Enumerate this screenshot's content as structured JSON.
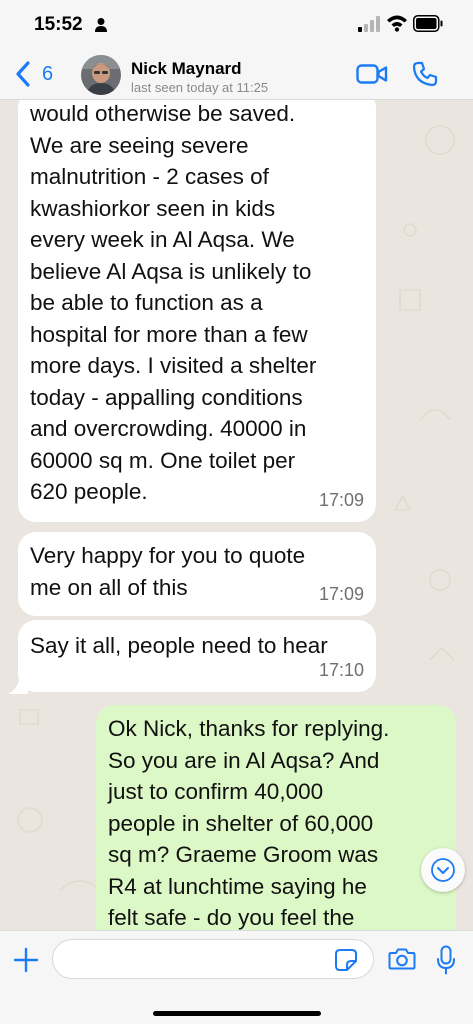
{
  "status_bar": {
    "time": "15:52"
  },
  "header": {
    "back_count": "6",
    "contact_name": "Nick Maynard",
    "last_seen": "last seen today at 11:25"
  },
  "messages": [
    {
      "direction": "incoming",
      "text": "would otherwise be saved.\nWe are seeing severe\nmalnutrition - 2 cases of\nkwashiorkor seen in kids\nevery week in Al Aqsa. We\nbelieve Al Aqsa is unlikely to\nbe able to function as a\nhospital for more than a few\nmore days. I visited a shelter\ntoday - appalling conditions\nand overcrowding. 40000 in\n60000 sq m. One toilet per\n620 people.",
      "time": "17:09"
    },
    {
      "direction": "incoming",
      "text": "Very happy for you to quote\nme on all of this",
      "time": "17:09"
    },
    {
      "direction": "incoming",
      "text": "Say it all, people need to hear",
      "time": "17:10"
    },
    {
      "direction": "outgoing",
      "text": "Ok Nick, thanks for replying.\nSo you are in Al Aqsa? And\njust to confirm 40,000\npeople in shelter of 60,000\nsq m? Graeme Groom was\nR4 at lunchtime saying he\nfelt safe - do you feel the",
      "time": ""
    }
  ],
  "input_bar": {
    "placeholder": ""
  },
  "colors": {
    "accent": "#1b7bf5",
    "incoming_bubble": "#ffffff",
    "outgoing_bubble": "#dcf8c6",
    "chat_background": "#ebe5df"
  },
  "icons": [
    "person-icon",
    "signal-icon",
    "wifi-icon",
    "battery-icon",
    "chevron-left-icon",
    "video-camera-icon",
    "phone-icon",
    "chevron-down-icon",
    "plus-icon",
    "sticker-icon",
    "camera-icon",
    "microphone-icon"
  ]
}
